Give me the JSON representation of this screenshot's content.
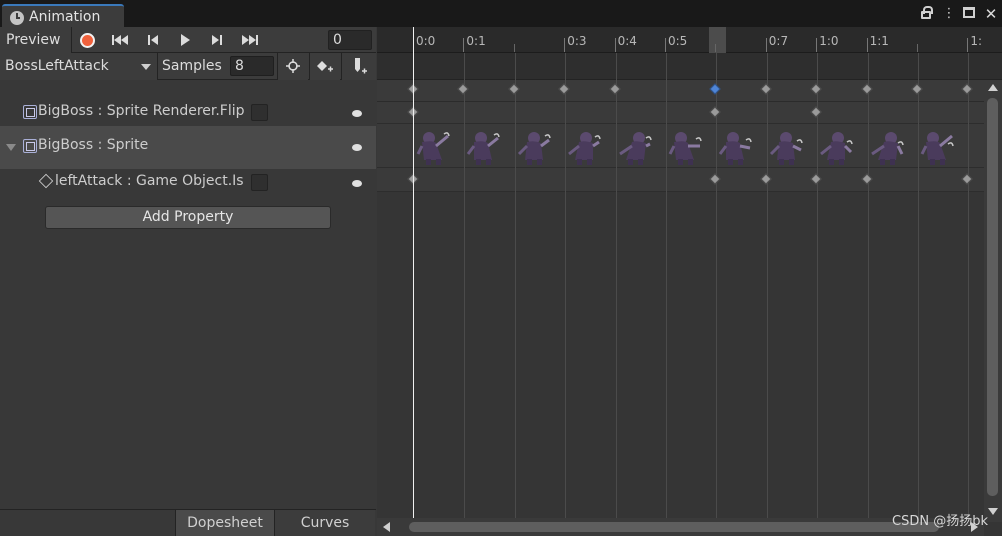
{
  "tab": {
    "title": "Animation"
  },
  "controls": {
    "preview_label": "Preview",
    "frame_value": "0"
  },
  "clip": {
    "name": "BossLeftAttack",
    "samples_label": "Samples",
    "samples_value": "8"
  },
  "properties": [
    {
      "label": "BigBoss : Sprite Renderer.Flip",
      "type": "component"
    },
    {
      "label": "BigBoss : Sprite",
      "type": "component"
    },
    {
      "label": "leftAttack : Game Object.Is",
      "type": "gameobject"
    }
  ],
  "add_property_label": "Add Property",
  "bottom_tabs": {
    "dopesheet": "Dopesheet",
    "curves": "Curves"
  },
  "ruler_labels": [
    "0:0",
    "0:1",
    "0:3",
    "0:4",
    "0:5",
    "0:7",
    "1:0",
    "1:1",
    "1:"
  ],
  "keyframes": {
    "summary_frames": [
      0,
      1,
      2,
      3,
      4,
      6,
      7,
      8,
      9,
      10,
      11
    ],
    "selected_frame": 6,
    "flip_frames": [
      0,
      6,
      8
    ],
    "sprite_frames": [
      0,
      1,
      2,
      3,
      4,
      5,
      6,
      7,
      8,
      9,
      10
    ],
    "active_frames": [
      0,
      6,
      7,
      8,
      9,
      11
    ]
  },
  "colors": {
    "accent": "#3a79bb",
    "record": "#f0613c",
    "selected_key": "#4f85d6"
  },
  "watermark": "CSDN @扬扬bk"
}
